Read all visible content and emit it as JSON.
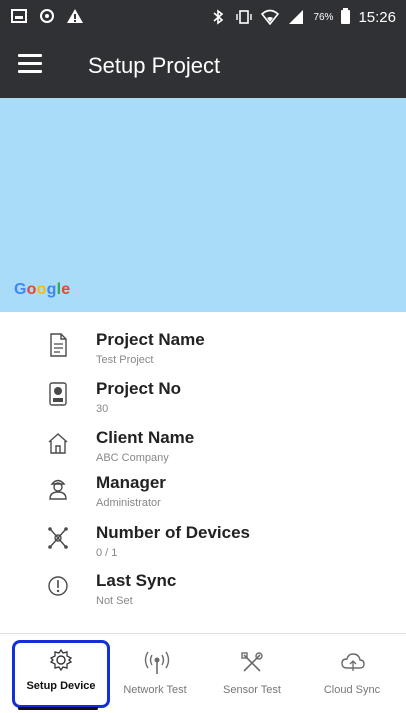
{
  "status_bar": {
    "battery": "76%",
    "time": "15:26",
    "left_icons": [
      "image-icon",
      "sync-icon",
      "warning-icon"
    ],
    "right_icons": [
      "bluetooth-icon",
      "vibrate-icon",
      "wifi-icon",
      "signal-icon",
      "battery-icon"
    ]
  },
  "app_bar": {
    "title": "Setup Project",
    "menu_icon": "menu-icon"
  },
  "map": {
    "provider_logo": "Google",
    "background_color": "#a9ddf7"
  },
  "project_info": [
    {
      "label": "Project Name",
      "value": "Test Project",
      "icon": "document-icon"
    },
    {
      "label": "Project No",
      "value": "30",
      "icon": "id-card-icon"
    },
    {
      "label": "Client Name",
      "value": "ABC Company",
      "icon": "home-icon"
    },
    {
      "label": "Manager",
      "value": "Administrator",
      "icon": "person-icon"
    },
    {
      "label": "Number of Devices",
      "value": "0 / 1",
      "icon": "network-nodes-icon"
    },
    {
      "label": "Last Sync",
      "value": "Not Set",
      "icon": "alert-circle-icon"
    }
  ],
  "bottom_nav": {
    "items": [
      {
        "label": "Setup Device",
        "icon": "gear-icon",
        "active": true
      },
      {
        "label": "Network Test",
        "icon": "broadcast-icon",
        "active": false
      },
      {
        "label": "Sensor Test",
        "icon": "tools-icon",
        "active": false
      },
      {
        "label": "Cloud Sync",
        "icon": "cloud-sync-icon",
        "active": false
      }
    ]
  },
  "colors": {
    "app_bar": "#2f3135",
    "active_highlight": "#1330d8",
    "map": "#a9ddf7"
  }
}
